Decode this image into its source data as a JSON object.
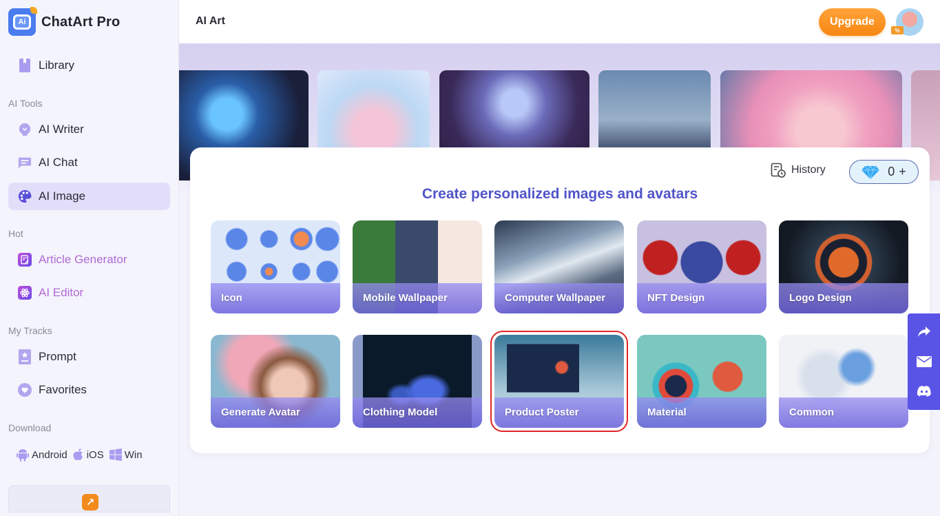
{
  "app": {
    "brand_name": "ChatArt Pro",
    "logo_text": "Ai"
  },
  "sidebar": {
    "library": "Library",
    "sections": {
      "ai_tools": "AI Tools",
      "hot": "Hot",
      "my_tracks": "My Tracks",
      "download": "Download"
    },
    "ai_tools": [
      {
        "label": "AI Writer",
        "icon": "lightbulb-icon"
      },
      {
        "label": "AI Chat",
        "icon": "chat-icon"
      },
      {
        "label": "AI Image",
        "icon": "palette-icon",
        "active": true
      }
    ],
    "hot": [
      {
        "label": "Article Generator",
        "icon": "article-edit-icon"
      },
      {
        "label": "AI Editor",
        "icon": "atom-icon"
      }
    ],
    "my_tracks": [
      {
        "label": "Prompt",
        "icon": "prompt-icon"
      },
      {
        "label": "Favorites",
        "icon": "heart-icon"
      }
    ],
    "downloads": [
      {
        "label": "Android",
        "icon": "android-icon"
      },
      {
        "label": "iOS",
        "icon": "apple-icon"
      },
      {
        "label": "Win",
        "icon": "windows-icon"
      }
    ],
    "promo_icon": "↗"
  },
  "header": {
    "title": "AI Art",
    "upgrade_label": "Upgrade",
    "avatar_badge": "%"
  },
  "panel": {
    "history_label": "History",
    "credits_count": "0",
    "credits_plus": "+",
    "title": "Create personalized images and avatars",
    "categories": [
      {
        "label": "Icon"
      },
      {
        "label": "Mobile Wallpaper"
      },
      {
        "label": "Computer Wallpaper"
      },
      {
        "label": "NFT Design"
      },
      {
        "label": "Logo Design"
      },
      {
        "label": "Generate Avatar"
      },
      {
        "label": "Clothing Model"
      },
      {
        "label": "Product Poster",
        "highlighted": true
      },
      {
        "label": "Material"
      },
      {
        "label": "Common"
      }
    ]
  },
  "float_bar": {
    "items": [
      "share-icon",
      "mail-icon",
      "discord-icon"
    ]
  },
  "colors": {
    "accent": "#5a54e6",
    "title_blue": "#5054c8",
    "upgrade_orange": "#f78612",
    "active_bg": "#e2defa",
    "hot_text": "#b06ad6"
  }
}
